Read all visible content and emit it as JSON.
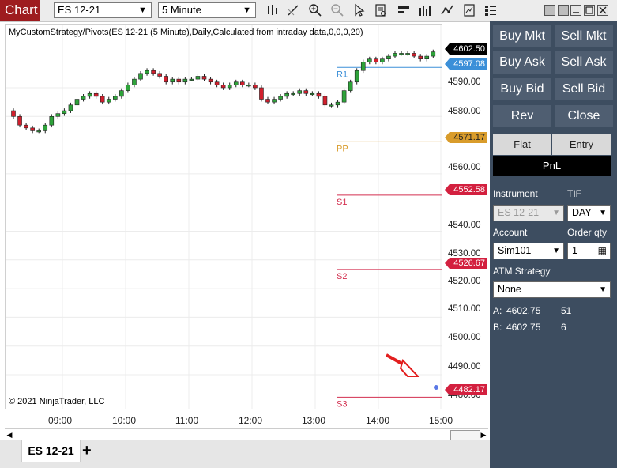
{
  "toolbar": {
    "chart_tab": "Chart",
    "instrument": "ES 12-21",
    "interval": "5 Minute"
  },
  "chart": {
    "title": "MyCustomStrategy/Pivots(ES 12-21 (5 Minute),Daily,Calculated from intraday data,0,0,0,20)",
    "copyright": "© 2021 NinjaTrader, LLC",
    "price_labels": [
      "4590.00",
      "4580.00",
      "4560.00",
      "4540.00",
      "4530.00",
      "4520.00",
      "4510.00",
      "4500.00",
      "4490.00",
      "4480.00"
    ],
    "time_labels": [
      "09:00",
      "10:00",
      "11:00",
      "12:00",
      "13:00",
      "14:00",
      "15:00"
    ],
    "pivots": [
      {
        "label": "R1",
        "value": "4597.08",
        "color": "#3b8fd8"
      },
      {
        "label": "PP",
        "value": "4571.17",
        "color": "#d99c2b"
      },
      {
        "label": "S1",
        "value": "4552.58",
        "color": "#d32f4f"
      },
      {
        "label": "S2",
        "value": "4526.67",
        "color": "#d32f4f"
      },
      {
        "label": "S3",
        "value": "4482.17",
        "color": "#d32f4f"
      }
    ],
    "last_price": "4602.50"
  },
  "tabs": {
    "active": "ES 12-21",
    "add": "+"
  },
  "chart_trader": {
    "buy_mkt": "Buy Mkt",
    "sell_mkt": "Sell Mkt",
    "buy_ask": "Buy Ask",
    "sell_ask": "Sell Ask",
    "buy_bid": "Buy Bid",
    "sell_bid": "Sell Bid",
    "rev": "Rev",
    "close": "Close",
    "flat": "Flat",
    "entry": "Entry",
    "pnl": "PnL",
    "instrument_label": "Instrument",
    "instrument_value": "ES 12-21",
    "tif_label": "TIF",
    "tif_value": "DAY",
    "account_label": "Account",
    "account_value": "Sim101",
    "order_qty_label": "Order qty",
    "order_qty_value": "1",
    "atm_label": "ATM Strategy",
    "atm_value": "None",
    "ask_label": "A:",
    "ask_price": "4602.75",
    "ask_size": "51",
    "bid_label": "B:",
    "bid_price": "4602.75",
    "bid_size": "6"
  },
  "colors": {
    "chart_tab": "#9e1c1f",
    "up_candle": "#2ea33a",
    "down_candle": "#d11f2d",
    "panel_bg": "#3d4d60",
    "button_bg": "#4f5e71"
  }
}
